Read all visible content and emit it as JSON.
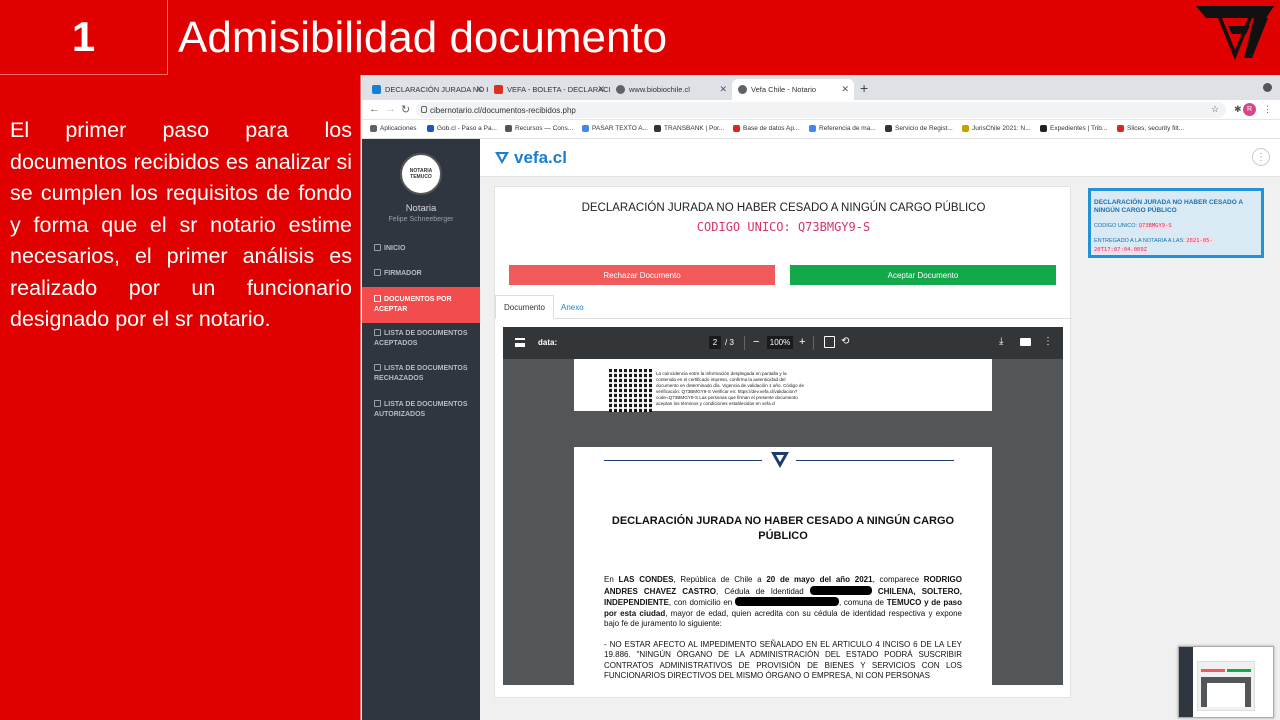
{
  "slide": {
    "number": "1",
    "title": "Admisibilidad documento",
    "description": "El primer paso para los documentos recibidos es analizar si se cumplen los requisitos de fondo y forma que el sr notario estime necesarios, el primer análisis es realizado por un funcionario designado por el sr notario."
  },
  "browser": {
    "tabs": [
      {
        "label": "DECLARACIÓN JURADA NO HA",
        "icon": "vefa-icon",
        "color": "#1a7fd0"
      },
      {
        "label": "VEFA - BOLETA - DECLARACIÓ",
        "icon": "gmail-icon",
        "color": "#d93025"
      },
      {
        "label": "www.biobiochile.cl",
        "icon": "globe-icon",
        "color": "#5f6368"
      },
      {
        "label": "Vefa Chile - Notario",
        "icon": "globe-icon",
        "color": "#5f6368"
      }
    ],
    "url": "cibernotario.cl/documentos-recibidos.php",
    "avatar_letter": "R",
    "bookmarks": [
      {
        "label": "Aplicaciones",
        "color": "#5f6368"
      },
      {
        "label": "Gob.cl - Paso a Pa...",
        "color": "#1a56c8"
      },
      {
        "label": "Recursos — Cons...",
        "color": "#555555"
      },
      {
        "label": "PASAR TEXTO A...",
        "color": "#4285f4"
      },
      {
        "label": "TRANSBANK | Por...",
        "color": "#333333"
      },
      {
        "label": "Base de datos Ap...",
        "color": "#e62117"
      },
      {
        "label": "Referencia de ma...",
        "color": "#4285f4"
      },
      {
        "label": "Servicio de Regist...",
        "color": "#333333"
      },
      {
        "label": "JurisChile 2021: N...",
        "color": "#c5a100"
      },
      {
        "label": "Expedientes | Trib...",
        "color": "#222222"
      },
      {
        "label": "Slices, security filt...",
        "color": "#e62117"
      }
    ]
  },
  "app": {
    "brand": "vefa.cl",
    "seal_text": "NOTARIA TEMUCO",
    "role": "Notaria",
    "user": "Felipe Schneeberger",
    "menu": [
      {
        "label": "INICIO",
        "active": false
      },
      {
        "label": "FIRMADOR",
        "active": false
      },
      {
        "label": "DOCUMENTOS POR ACEPTAR",
        "active": true
      },
      {
        "label": "LISTA DE DOCUMENTOS ACEPTADOS",
        "active": false
      },
      {
        "label": "LISTA DE DOCUMENTOS RECHAZADOS",
        "active": false
      },
      {
        "label": "LISTA DE DOCUMENTOS AUTORIZADOS",
        "active": false
      }
    ],
    "document": {
      "title": "DECLARACIÓN JURADA NO HABER CESADO A NINGÚN CARGO PÚBLICO",
      "code": "CODIGO UNICO: Q73BMGY9-S",
      "reject_label": "Rechazar Documento",
      "accept_label": "Aceptar Documento",
      "tab_document": "Documento",
      "tab_annex": "Anexo"
    },
    "viewer": {
      "file_name": "data:",
      "page_current": "2",
      "page_total": "/ 3",
      "zoom": "100%",
      "qr_text": "La coincidencia entre la información desplegada en pantalla y la contenida en el certificado impreso, confirma la autenticidad del documento en determinado día. Vigencia de validación 1 año. Código de verificación: Q73BMGY9-S Verificar en: https://dev.vefa.cl/validacion?code=Q73BMGY9-S Las personas que firman el presente documento aceptan los términos y condiciones establecidos en vefa.cl",
      "page_title": "DECLARACIÓN JURADA NO HABER CESADO A NINGÚN CARGO PÚBLICO",
      "para1": {
        "t1": "En ",
        "b1": "LAS CONDES",
        "t2": ", República de Chile a ",
        "b2": "20 de mayo del año 2021",
        "t3": ", comparece ",
        "b3": "RODRIGO ANDRES CHAVEZ CASTRO",
        "t4": ", Cédula de Identidad ",
        "b4": "CHILENA, SOLTERO, INDEPENDIENTE",
        "t5": ", con domicilio en ",
        "t6": ", comuna de ",
        "b5": "TEMUCO y de paso por esta ciudad",
        "t7": ", mayor de edad, quien acredita con su cédula de identidad respectiva y expone bajo fe de juramento lo siguiente:"
      },
      "para2": "- NO ESTAR AFECTO AL IMPEDIMENTO SEÑALADO EN EL ARTICULO 4 INCISO 6 DE LA LEY 19.886. \"NINGÚN ÓRGANO DE LA ADMINISTRACIÓN DEL ESTADO PODRÁ SUSCRIBIR CONTRATOS ADMINISTRATIVOS DE PROVISIÓN DE BIENES Y SERVICIOS CON LOS FUNCIONARIOS DIRECTIVOS DEL MISMO ÓRGANO O EMPRESA, NI CON PERSONAS"
    },
    "summary": {
      "title": "DECLARACIÓN JURADA NO HABER CESADO A NINGÚN CARGO PÚBLICO",
      "code_label": "CODIGO UNICO:",
      "code": "Q73BMGY9-S",
      "delivered_label": "ENTREGADO A LA NOTARIA A LAS:",
      "delivered_value": "2021-05-20T17:07:04.009Z"
    }
  }
}
